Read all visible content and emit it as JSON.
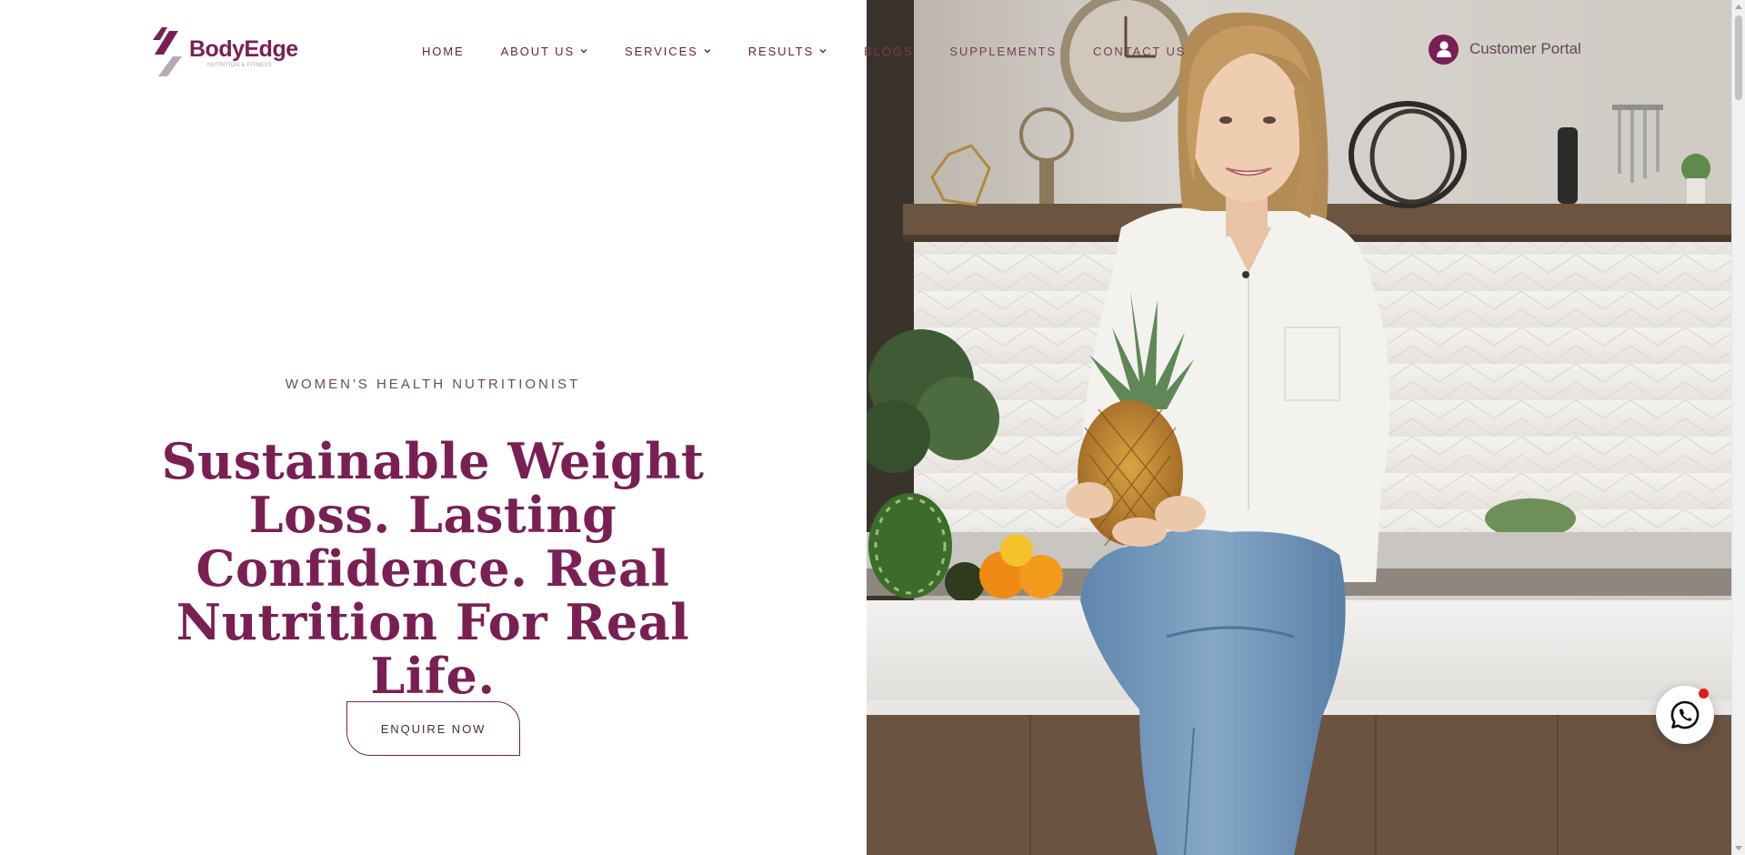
{
  "brand": {
    "name": "BodyEdge",
    "tagline": "NUTRITION & FITNESS",
    "primary_color": "#7a1f53"
  },
  "nav": {
    "items": [
      {
        "label": "HOME",
        "has_dropdown": false
      },
      {
        "label": "ABOUT US",
        "has_dropdown": true
      },
      {
        "label": "SERVICES",
        "has_dropdown": true
      },
      {
        "label": "RESULTS",
        "has_dropdown": true
      },
      {
        "label": "BLOGS",
        "has_dropdown": false
      },
      {
        "label": "SUPPLEMENTS",
        "has_dropdown": false
      },
      {
        "label": "CONTACT US",
        "has_dropdown": false
      }
    ]
  },
  "portal": {
    "label": "Customer Portal",
    "icon": "user-icon"
  },
  "hero": {
    "eyebrow": "WOMEN'S HEALTH NUTRITIONIST",
    "headline_lines": [
      "Sustainable Weight",
      "Loss. Lasting",
      "Confidence. Real",
      "Nutrition For Real Life."
    ],
    "cta_label": "ENQUIRE NOW",
    "image": "woman-holding-pineapple-in-kitchen-photo"
  },
  "whatsapp": {
    "icon": "whatsapp-icon",
    "notification_color": "#e31b1b"
  }
}
